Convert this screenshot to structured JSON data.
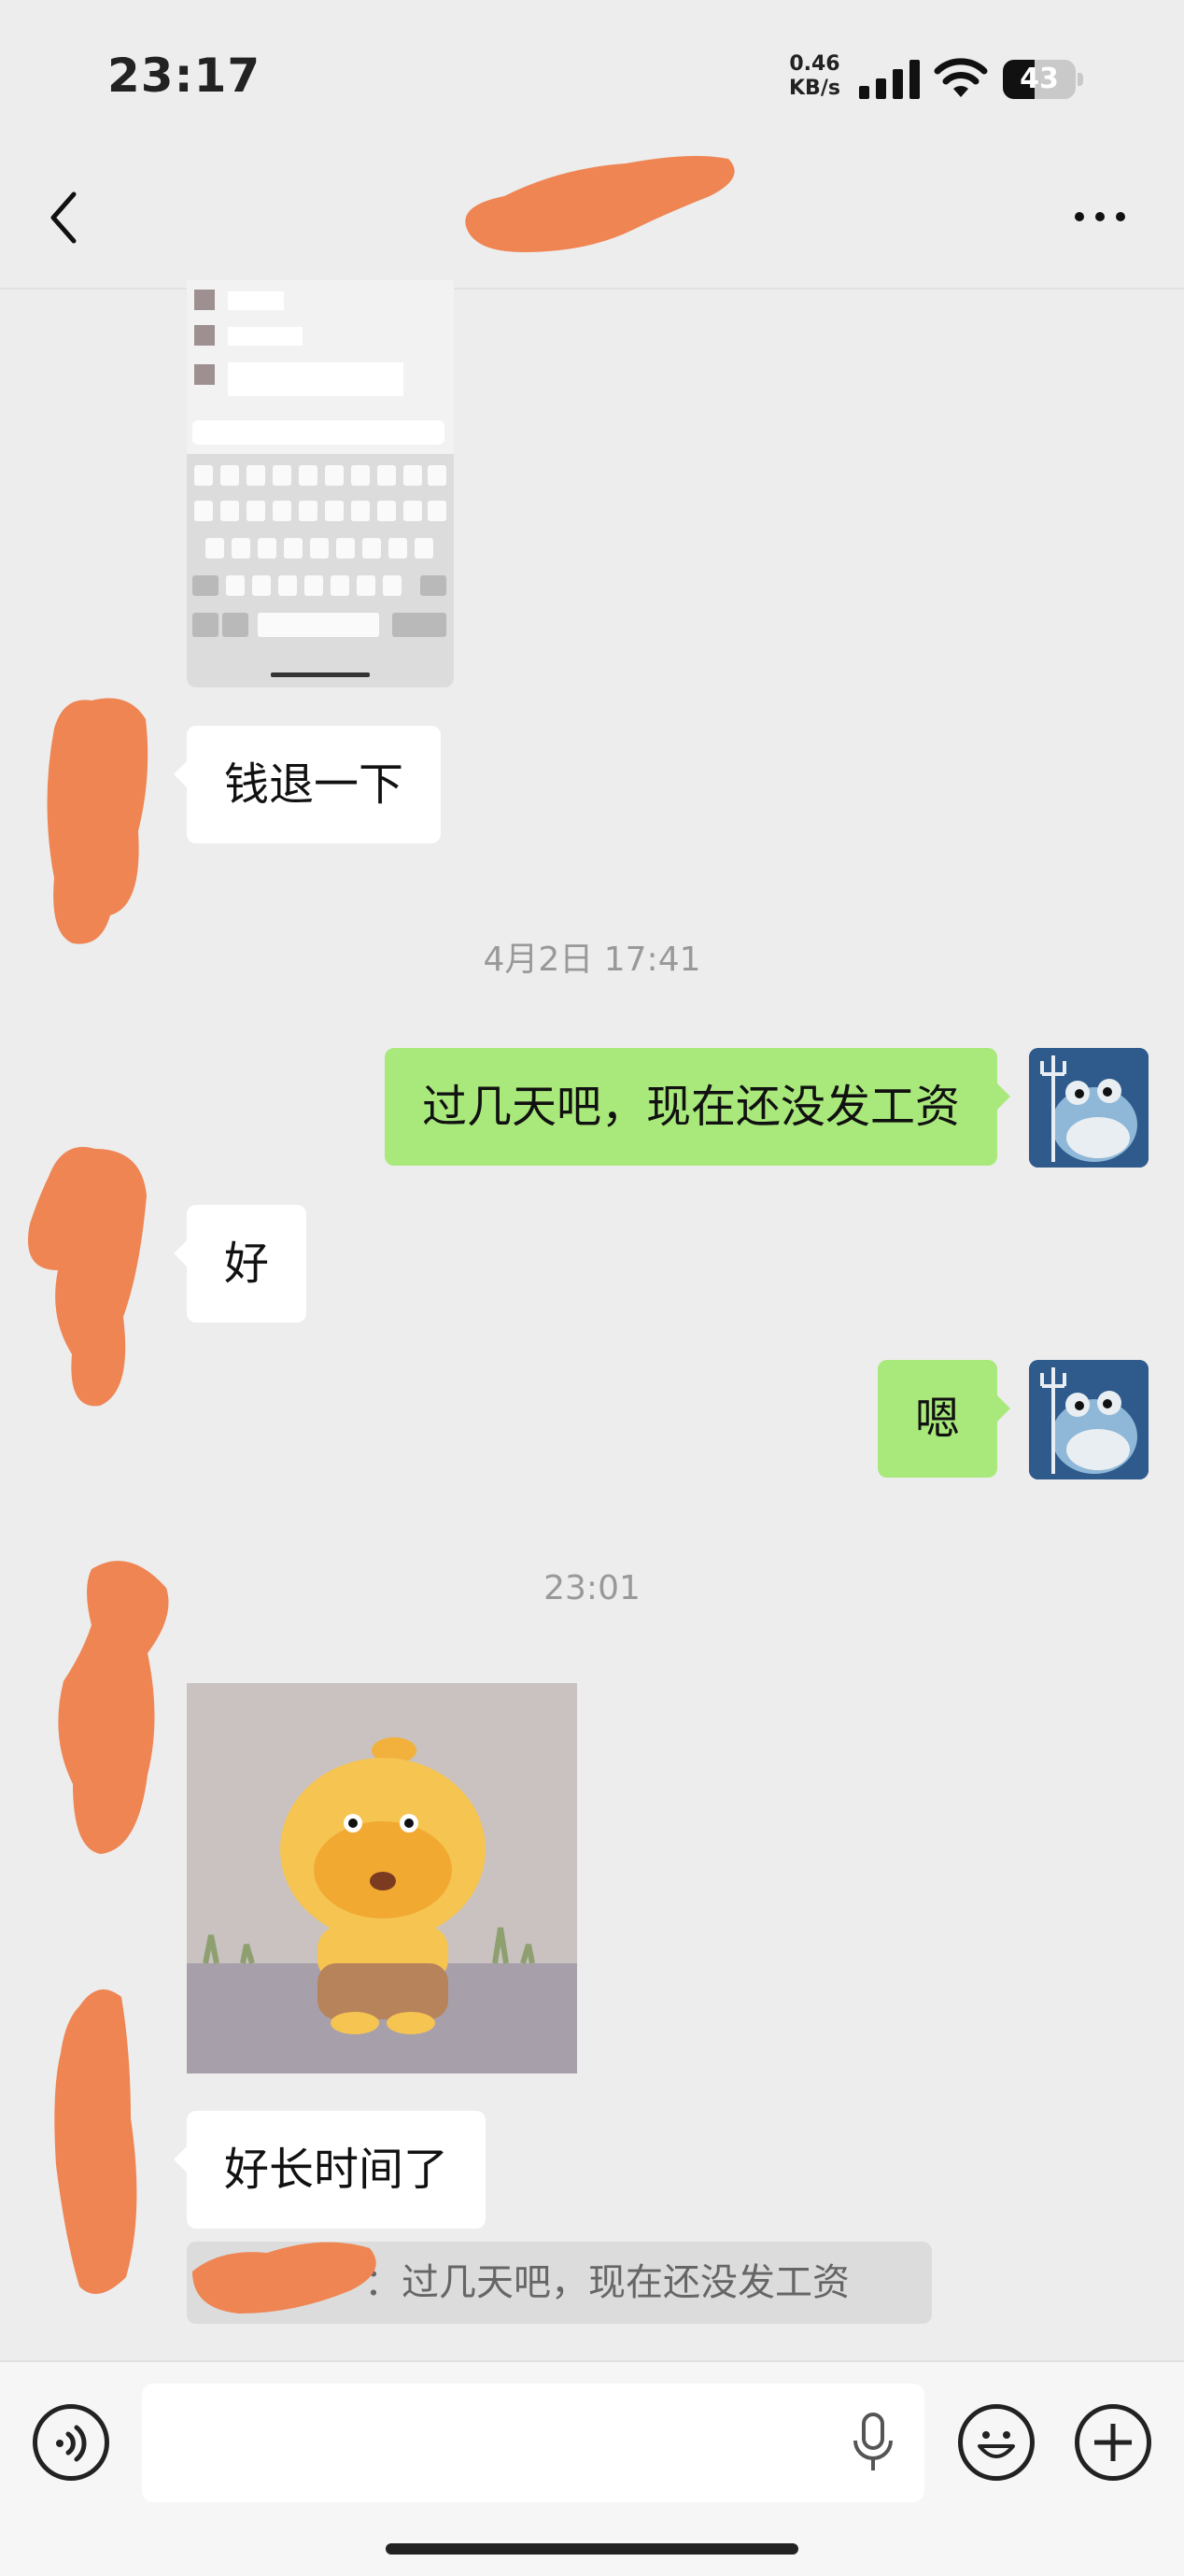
{
  "status_bar": {
    "time": "23:17",
    "net_speed_value": "0.46",
    "net_speed_unit": "KB/s",
    "battery_level": "43",
    "icons": [
      "signal-icon",
      "wifi-icon",
      "battery-icon"
    ]
  },
  "nav": {
    "back_icon": "chevron-left-icon",
    "more_icon": "more-icon"
  },
  "messages": {
    "m1": "钱退一下",
    "timestamp1": "4月2日 17:41",
    "m2": "过几天吧，现在还没发工资",
    "m3": "好",
    "m4": "嗯",
    "timestamp2": "23:01",
    "m5": "好长时间了",
    "quote_text": "：过几天吧，现在还没发工资"
  },
  "input_bar": {
    "voice_icon": "voice-icon",
    "mic_icon": "mic-icon",
    "emoji_icon": "emoji-icon",
    "plus_icon": "plus-icon"
  },
  "colors": {
    "sent_bubble": "#a9e97b",
    "received_bubble": "#ffffff",
    "background": "#ededed",
    "redaction": "#ee8553"
  }
}
